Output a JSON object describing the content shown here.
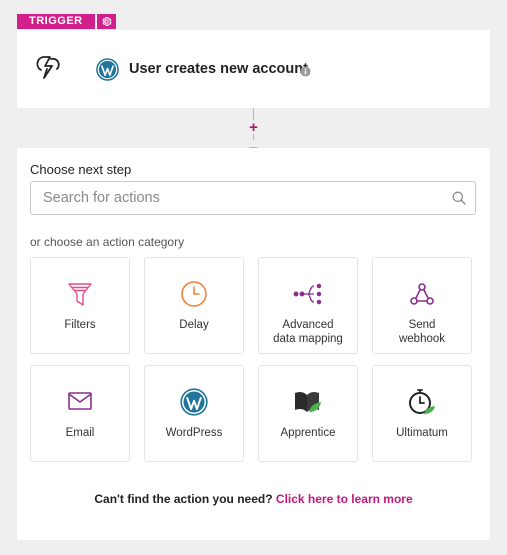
{
  "trigger": {
    "tag_label": "TRIGGER",
    "title": "User creates new account",
    "icons": [
      "gear-icon",
      "bolt-icon",
      "wordpress-icon",
      "info-icon"
    ]
  },
  "connector": {
    "add_label": "+"
  },
  "panel": {
    "title": "Choose next step",
    "search_placeholder": "Search for actions",
    "category_label": "or choose an action category",
    "categories": [
      {
        "label": "Filters",
        "icon": "filter-icon"
      },
      {
        "label": "Delay",
        "icon": "clock-icon"
      },
      {
        "label": "Advanced\ndata mapping",
        "icon": "data-mapping-icon"
      },
      {
        "label": "Send\nwebhook",
        "icon": "webhook-icon"
      },
      {
        "label": "Email",
        "icon": "email-icon"
      },
      {
        "label": "WordPress",
        "icon": "wordpress-icon"
      },
      {
        "label": "Apprentice",
        "icon": "apprentice-icon"
      },
      {
        "label": "Ultimatum",
        "icon": "ultimatum-icon"
      }
    ],
    "footer_text": "Can't find the action you need?",
    "footer_link": "Click here to learn more"
  },
  "colors": {
    "accent": "#d21f8c",
    "link": "#c2187e",
    "delay": "#f0833a",
    "purple": "#8a2d8f"
  }
}
